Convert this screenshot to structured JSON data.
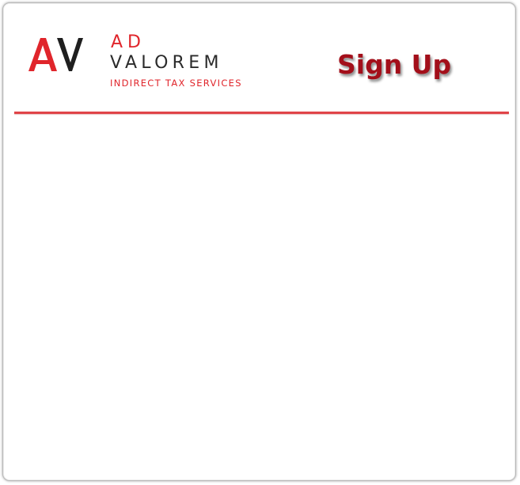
{
  "brand": {
    "logo_mark": "AV",
    "line1": "AD",
    "line2": "VALOREM",
    "line3": "INDIRECT TAX SERVICES"
  },
  "page": {
    "title": "Sign Up"
  },
  "colors": {
    "brand_red": "#e0252b",
    "title_red": "#a30f1a",
    "divider": "#e04448",
    "dark_text": "#2b2b2b"
  }
}
